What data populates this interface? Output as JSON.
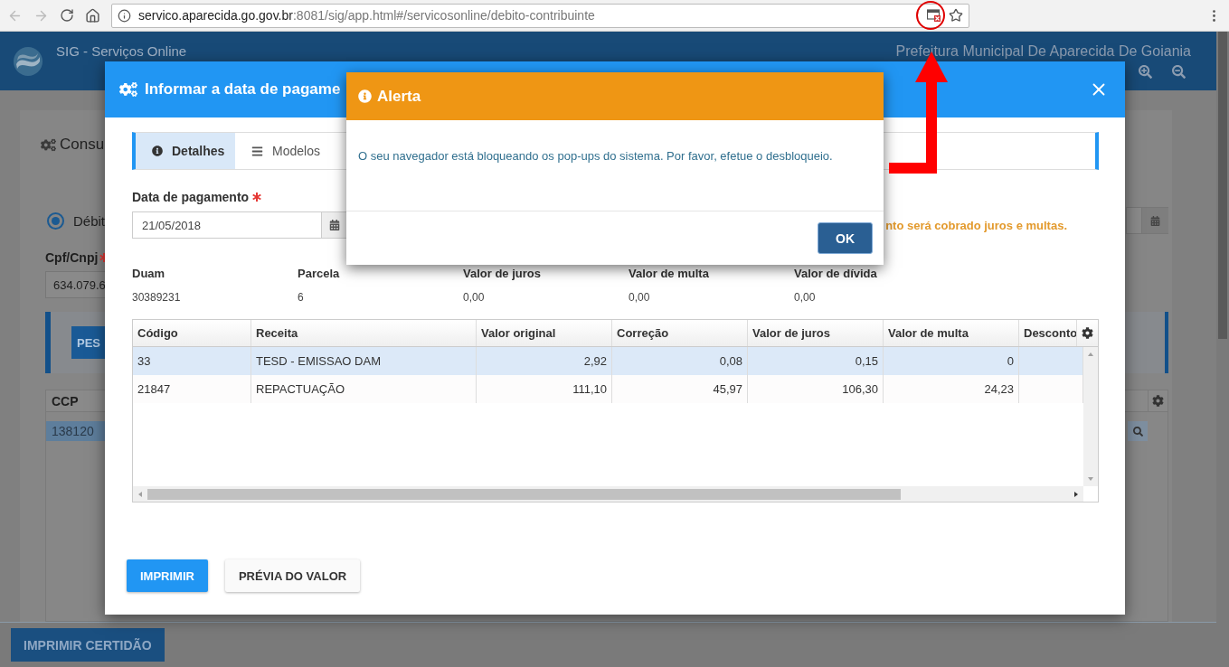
{
  "browser": {
    "url_host": "servico.aparecida.go.gov.br",
    "url_path": ":8081/sig/app.html#/servicosonline/debito-contribuinte",
    "popup_blocked": true
  },
  "app": {
    "title": "SIG - Serviços Online",
    "organization": "Prefeitura Municipal De Aparecida De Goiania"
  },
  "consulta": {
    "heading": "Consu",
    "radio": {
      "label": "Débit",
      "selected": true
    },
    "cpf_label": "Cpf/Cnpj",
    "cpf_required": true,
    "cpf_value": "634.079.6",
    "search_button": "PES",
    "grid": {
      "column": "CCP",
      "rows": [
        {
          "value": "138120",
          "selected": true
        }
      ]
    },
    "print_button": "IMPRIMIR CERTIDÃO"
  },
  "modal": {
    "title": "Informar a data de pagame",
    "tabs": [
      {
        "label": "Detalhes",
        "selected": true
      },
      {
        "label": "Modelos",
        "selected": false
      }
    ],
    "date_label": "Data de pagamento",
    "date_required": true,
    "date_value": "21/05/2018",
    "warning": "nto será cobrado juros e multas.",
    "summary": [
      {
        "label": "Duam",
        "value": "30389231"
      },
      {
        "label": "Parcela",
        "value": "6"
      },
      {
        "label": "Valor de juros",
        "value": "0,00"
      },
      {
        "label": "Valor de multa",
        "value": "0,00"
      },
      {
        "label": "Valor de dívida",
        "value": "0,00"
      }
    ],
    "table": {
      "columns": [
        {
          "label": "Código",
          "kind": "text"
        },
        {
          "label": "Receita",
          "kind": "text"
        },
        {
          "label": "Valor original",
          "kind": "number"
        },
        {
          "label": "Correção",
          "kind": "number"
        },
        {
          "label": "Valor de juros",
          "kind": "number"
        },
        {
          "label": "Valor de multa",
          "kind": "number"
        },
        {
          "label": "Desconto",
          "kind": "number"
        }
      ],
      "rows": [
        {
          "cells": [
            "33",
            "TESD - EMISSAO DAM",
            "2,92",
            "0,08",
            "0,15",
            "0"
          ],
          "selected": true
        },
        {
          "cells": [
            "21847",
            "REPACTUAÇÃO",
            "111,10",
            "45,97",
            "106,30",
            "24,23"
          ],
          "selected": false
        }
      ]
    },
    "buttons": [
      {
        "label": "IMPRIMIR",
        "kind": "primary"
      },
      {
        "label": "PRÉVIA DO VALOR",
        "kind": "default"
      }
    ]
  },
  "alert": {
    "title": "Alerta",
    "message": "O seu navegador está bloqueando os pop-ups do sistema. Por favor, efetue o desbloqueio.",
    "button": "OK"
  }
}
